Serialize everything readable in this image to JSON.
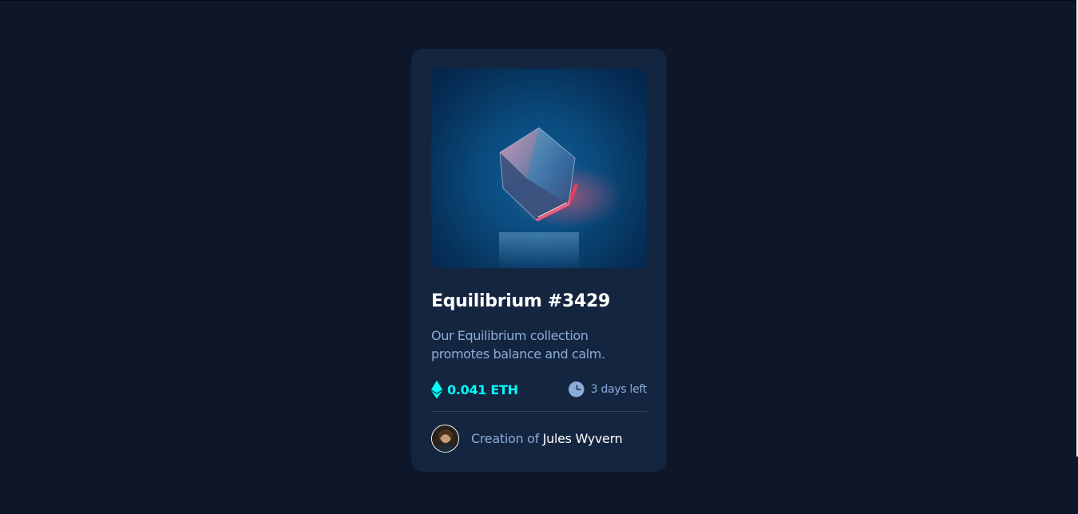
{
  "card": {
    "title": "Equilibrium #3429",
    "description": "Our Equilibrium collection promotes balance and calm.",
    "price": "0.041 ETH",
    "time_left": "3 days left",
    "creator_prefix": "Creation of",
    "creator_name": "Jules Wyvern"
  },
  "icons": {
    "price": "ethereum-icon",
    "time": "clock-icon"
  },
  "colors": {
    "page_background": "#0d1729",
    "card_background": "#14253f",
    "accent_cyan": "#00fff8",
    "soft_blue": "#8bacd9",
    "divider": "#2e405a",
    "white": "#ffffff"
  }
}
